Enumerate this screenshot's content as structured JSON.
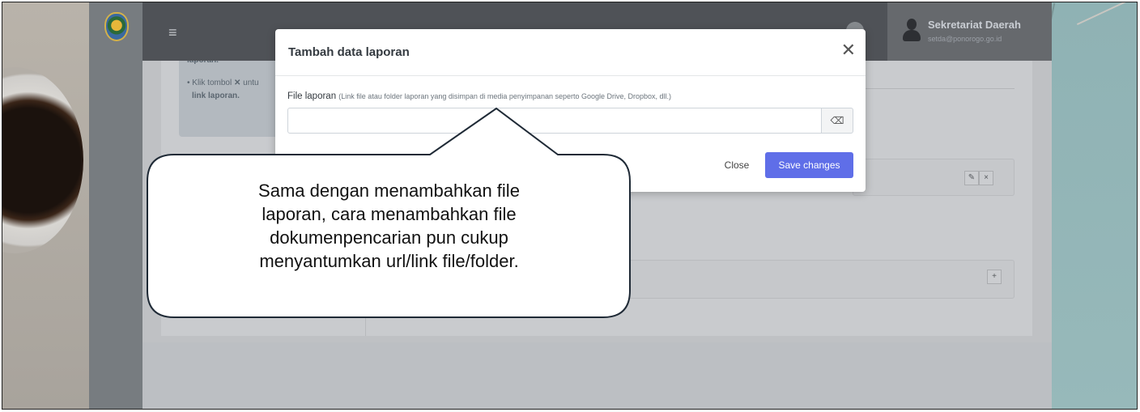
{
  "user": {
    "name": "Sekretariat Daerah",
    "email": "setda@ponorogo.go.id"
  },
  "info": {
    "line_top": "laporan.",
    "bullet_prefix": "• Klik tombol ",
    "bullet_x": "✕",
    "bullet_mid": " untu",
    "bullet_end": "link laporan."
  },
  "icons": {
    "menu": "≡",
    "close": "✕",
    "eraser": "⌫",
    "edit": "✎",
    "remove": "×",
    "add": "+"
  },
  "modal": {
    "title": "Tambah data laporan",
    "field_label": "File laporan",
    "field_hint": "(Link file atau folder laporan yang disimpan di media penyimpanan seperto Google Drive, Dropbox, dll.)",
    "field_value": "",
    "close_label": "Close",
    "save_label": "Save changes"
  },
  "callout": {
    "line1": "Sama dengan menambahkan file",
    "line2": "laporan, cara menambahkan file",
    "line3": "dokumenpencarian pun cukup",
    "line4": "menyantumkan url/link file/folder."
  }
}
